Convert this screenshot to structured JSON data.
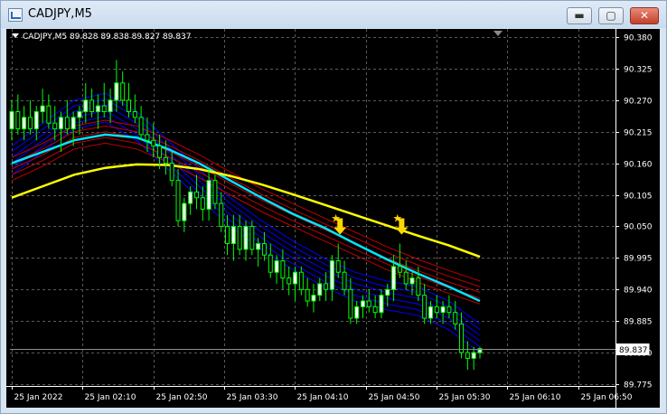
{
  "window": {
    "title": "CADJPY,M5",
    "minimize_glyph": "▬",
    "maximize_glyph": "▢",
    "close_glyph": "✕"
  },
  "chart": {
    "symbol_line": "CADJPY,M5  89.828 89.838 89.827 89.837",
    "current_price": "89.837",
    "price_ticks": [
      "90.380",
      "90.325",
      "90.270",
      "90.215",
      "90.160",
      "90.105",
      "90.050",
      "89.995",
      "89.940",
      "89.885",
      "89.830",
      "89.775"
    ],
    "time_ticks": [
      "25 Jan 2022",
      "25 Jan 02:10",
      "25 Jan 02:50",
      "25 Jan 03:30",
      "25 Jan 04:10",
      "25 Jan 04:50",
      "25 Jan 05:30",
      "25 Jan 06:10",
      "25 Jan 06:50"
    ],
    "colors": {
      "background": "#000000",
      "grid": "#5a5a5a",
      "bull_candle": "#ffffff",
      "bear_candle": "#00ff00",
      "slow_ma": "#ffff00",
      "mid_ma": "#00e5ff",
      "red_band": "#c00000",
      "blue_band": "#0000ff",
      "signal": "#ffd700"
    },
    "icons": {
      "sell_signal": "down-arrow-icon",
      "star_signal": "star-icon"
    }
  },
  "chart_data": {
    "type": "candlestick",
    "symbol": "CADJPY",
    "timeframe": "M5",
    "ohlc_header": {
      "open": 89.828,
      "high": 89.838,
      "low": 89.827,
      "close": 89.837
    },
    "ylim": [
      89.775,
      90.38
    ],
    "x_ticks": [
      "25 Jan 2022",
      "25 Jan 02:10",
      "25 Jan 02:50",
      "25 Jan 03:30",
      "25 Jan 04:10",
      "25 Jan 04:50",
      "25 Jan 05:30",
      "25 Jan 06:10",
      "25 Jan 06:50"
    ],
    "candles": [
      [
        90.22,
        90.27,
        90.2,
        90.25
      ],
      [
        90.25,
        90.28,
        90.21,
        90.22
      ],
      [
        90.22,
        90.26,
        90.2,
        90.24
      ],
      [
        90.24,
        90.27,
        90.21,
        90.22
      ],
      [
        90.22,
        90.26,
        90.2,
        90.25
      ],
      [
        90.25,
        90.29,
        90.23,
        90.26
      ],
      [
        90.26,
        90.28,
        90.22,
        90.23
      ],
      [
        90.23,
        90.26,
        90.2,
        90.22
      ],
      [
        90.22,
        90.25,
        90.18,
        90.24
      ],
      [
        90.24,
        90.27,
        90.21,
        90.22
      ],
      [
        90.22,
        90.25,
        90.19,
        90.24
      ],
      [
        90.24,
        90.26,
        90.21,
        90.25
      ],
      [
        90.25,
        90.3,
        90.23,
        90.27
      ],
      [
        90.27,
        90.29,
        90.24,
        90.25
      ],
      [
        90.25,
        90.28,
        90.22,
        90.26
      ],
      [
        90.26,
        90.3,
        90.24,
        90.25
      ],
      [
        90.25,
        90.29,
        90.23,
        90.27
      ],
      [
        90.27,
        90.34,
        90.25,
        90.3
      ],
      [
        90.3,
        90.32,
        90.26,
        90.27
      ],
      [
        90.27,
        90.3,
        90.24,
        90.25
      ],
      [
        90.25,
        90.28,
        90.23,
        90.24
      ],
      [
        90.24,
        90.26,
        90.2,
        90.21
      ],
      [
        90.21,
        90.24,
        90.18,
        90.2
      ],
      [
        90.2,
        90.23,
        90.17,
        90.19
      ],
      [
        90.19,
        90.21,
        90.15,
        90.17
      ],
      [
        90.17,
        90.2,
        90.14,
        90.16
      ],
      [
        90.16,
        90.18,
        90.12,
        90.13
      ],
      [
        90.13,
        90.15,
        90.05,
        90.06
      ],
      [
        90.06,
        90.1,
        90.04,
        90.09
      ],
      [
        90.09,
        90.12,
        90.07,
        90.11
      ],
      [
        90.11,
        90.14,
        90.08,
        90.1
      ],
      [
        90.1,
        90.12,
        90.06,
        90.08
      ],
      [
        90.08,
        90.15,
        90.06,
        90.13
      ],
      [
        90.13,
        90.14,
        90.08,
        90.09
      ],
      [
        90.09,
        90.11,
        90.04,
        90.05
      ],
      [
        90.05,
        90.07,
        90.0,
        90.02
      ],
      [
        90.02,
        90.07,
        89.99,
        90.05
      ],
      [
        90.05,
        90.07,
        90.0,
        90.01
      ],
      [
        90.01,
        90.06,
        89.99,
        90.05
      ],
      [
        90.05,
        90.06,
        90.0,
        90.01
      ],
      [
        90.01,
        90.03,
        89.98,
        90.02
      ],
      [
        90.02,
        90.04,
        89.99,
        90.0
      ],
      [
        90.0,
        90.02,
        89.96,
        89.97
      ],
      [
        89.97,
        90.0,
        89.95,
        89.99
      ],
      [
        89.99,
        90.01,
        89.94,
        89.96
      ],
      [
        89.96,
        89.98,
        89.93,
        89.95
      ],
      [
        89.95,
        89.98,
        89.92,
        89.97
      ],
      [
        89.97,
        89.98,
        89.93,
        89.94
      ],
      [
        89.94,
        89.96,
        89.91,
        89.92
      ],
      [
        89.92,
        89.95,
        89.9,
        89.93
      ],
      [
        89.93,
        89.96,
        89.92,
        89.95
      ],
      [
        89.95,
        89.97,
        89.92,
        89.94
      ],
      [
        89.94,
        90.0,
        89.92,
        89.99
      ],
      [
        89.99,
        90.02,
        89.96,
        89.97
      ],
      [
        89.97,
        89.99,
        89.93,
        89.94
      ],
      [
        89.94,
        89.96,
        89.88,
        89.89
      ],
      [
        89.89,
        89.92,
        89.88,
        89.91
      ],
      [
        89.91,
        89.93,
        89.89,
        89.92
      ],
      [
        89.92,
        89.94,
        89.9,
        89.91
      ],
      [
        89.91,
        89.93,
        89.89,
        89.9
      ],
      [
        89.9,
        89.94,
        89.89,
        89.93
      ],
      [
        89.93,
        89.95,
        89.91,
        89.94
      ],
      [
        89.94,
        90.0,
        89.92,
        89.98
      ],
      [
        89.98,
        90.02,
        89.96,
        89.97
      ],
      [
        89.97,
        89.99,
        89.94,
        89.95
      ],
      [
        89.95,
        89.97,
        89.93,
        89.96
      ],
      [
        89.96,
        89.98,
        89.92,
        89.93
      ],
      [
        89.93,
        89.95,
        89.88,
        89.89
      ],
      [
        89.89,
        89.92,
        89.88,
        89.91
      ],
      [
        89.91,
        89.93,
        89.89,
        89.9
      ],
      [
        89.9,
        89.92,
        89.88,
        89.91
      ],
      [
        89.91,
        89.93,
        89.89,
        89.9
      ],
      [
        89.9,
        89.92,
        89.87,
        89.88
      ],
      [
        89.88,
        89.9,
        89.82,
        89.83
      ],
      [
        89.83,
        89.85,
        89.8,
        89.82
      ],
      [
        89.82,
        89.84,
        89.8,
        89.83
      ],
      [
        89.83,
        89.84,
        89.82,
        89.837
      ]
    ],
    "moving_averages": [
      {
        "color": "#ffff00",
        "points": [
          90.1,
          90.12,
          90.14,
          90.152,
          90.158,
          90.157,
          90.15,
          90.138,
          90.123,
          90.106,
          90.088,
          90.07,
          90.052,
          90.034,
          90.017,
          89.997
        ]
      },
      {
        "color": "#00e5ff",
        "points": [
          90.16,
          90.18,
          90.2,
          90.21,
          90.205,
          90.185,
          90.16,
          90.13,
          90.1,
          90.072,
          90.048,
          90.02,
          89.993,
          89.968,
          89.945,
          89.92
        ]
      },
      {
        "color": "#c00000",
        "points": [
          90.15,
          90.175,
          90.205,
          90.215,
          90.205,
          90.182,
          90.155,
          90.125,
          90.096,
          90.07,
          90.045,
          90.02,
          89.995,
          89.973,
          89.953,
          89.935
        ]
      },
      {
        "color": "#0000ff",
        "points": [
          90.17,
          90.21,
          90.25,
          90.262,
          90.23,
          90.18,
          90.13,
          90.08,
          90.04,
          90.005,
          89.975,
          89.95,
          89.935,
          89.925,
          89.9,
          89.86
        ]
      }
    ],
    "signals": [
      {
        "candle_index": 53,
        "type": "sell"
      },
      {
        "candle_index": 63,
        "type": "sell"
      }
    ],
    "grid": true
  }
}
